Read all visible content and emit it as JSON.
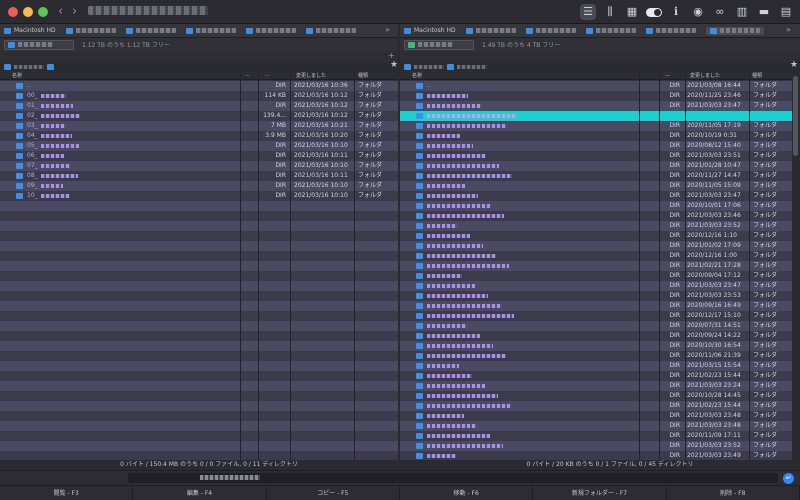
{
  "window": {
    "traffic": [
      "#ec5f59",
      "#f5bd4f",
      "#5fc454"
    ]
  },
  "toolbar": {
    "icons": [
      {
        "name": "list-view-icon",
        "glyph": "☰"
      },
      {
        "name": "columns-view-icon",
        "glyph": "⫼"
      },
      {
        "name": "grid-view-icon",
        "glyph": "▦"
      },
      {
        "name": "toggle-switch-icon",
        "glyph": ""
      },
      {
        "name": "info-icon",
        "glyph": "ℹ"
      },
      {
        "name": "eye-icon",
        "glyph": "◉"
      },
      {
        "name": "binoculars-icon",
        "glyph": "∞"
      },
      {
        "name": "panels-icon",
        "glyph": "▥"
      },
      {
        "name": "folder-icon",
        "glyph": "▬"
      },
      {
        "name": "sidebar-icon",
        "glyph": "▤"
      }
    ]
  },
  "left": {
    "tabs": [
      {
        "label": "Macintosh HD",
        "active": false
      },
      {
        "label": "",
        "active": false
      },
      {
        "label": "",
        "active": false
      },
      {
        "label": "",
        "active": false
      },
      {
        "label": "",
        "active": false
      },
      {
        "label": "",
        "active": false
      }
    ],
    "volume_info": "1.12 TB のうち 1.12 TB フリー",
    "headers": {
      "name": "名称",
      "ext": "...",
      "size": "...",
      "date": "変更しました",
      "kind": "種類"
    },
    "rows": [
      {
        "name": "..",
        "size": "DIR",
        "date": "2021/03/16 10:36",
        "kind": "フォルダ"
      },
      {
        "name": "00_",
        "size": "114 KB",
        "date": "2021/03/16 10:12",
        "kind": "フォルダ"
      },
      {
        "name": "01_",
        "size": "DIR",
        "date": "2021/03/16 10:12",
        "kind": "フォルダ"
      },
      {
        "name": "02_",
        "size": "139.4...",
        "date": "2021/03/16 10:12",
        "kind": "フォルダ"
      },
      {
        "name": "03_",
        "size": "7 MB",
        "date": "2021/03/16 10:21",
        "kind": "フォルダ"
      },
      {
        "name": "04_",
        "size": "3.9 MB",
        "date": "2021/03/16 10:20",
        "kind": "フォルダ"
      },
      {
        "name": "05_",
        "size": "DIR",
        "date": "2021/03/16 10:10",
        "kind": "フォルダ"
      },
      {
        "name": "06_",
        "size": "DIR",
        "date": "2021/03/16 10:11",
        "kind": "フォルダ"
      },
      {
        "name": "07_",
        "size": "DIR",
        "date": "2021/03/16 10:10",
        "kind": "フォルダ"
      },
      {
        "name": "08_",
        "size": "DIR",
        "date": "2021/03/16 10:11",
        "kind": "フォルダ"
      },
      {
        "name": "09_",
        "size": "DIR",
        "date": "2021/03/16 10:10",
        "kind": "フォルダ"
      },
      {
        "name": "10_",
        "size": "DIR",
        "date": "2021/03/16 10:10",
        "kind": "フォルダ"
      }
    ],
    "status": "0 バイト / 150.4 MB のうち 0 / 0 ファイル, 0 / 11 ディレクトリ"
  },
  "right": {
    "tabs": [
      {
        "label": "Macintosh HD",
        "active": false
      },
      {
        "label": "",
        "active": false
      },
      {
        "label": "",
        "active": false
      },
      {
        "label": "",
        "active": false
      },
      {
        "label": "",
        "active": false
      },
      {
        "label": "",
        "active": true
      }
    ],
    "volume_info": "1.49 TB のうち 4 TB フリー",
    "headers": {
      "name": "名称",
      "ext": "...",
      "size": "...",
      "date": "変更しました",
      "kind": "種類"
    },
    "rows": [
      {
        "name": "..",
        "size": "DIR",
        "date": "2021/03/08 16:44",
        "kind": "フォルダ"
      },
      {
        "name": "",
        "size": "DIR",
        "date": "2020/11/25 23:46",
        "kind": "フォルダ"
      },
      {
        "name": "",
        "size": "DIR",
        "date": "2021/03/03 23:47",
        "kind": "フォルダ"
      },
      {
        "name": "",
        "size": "",
        "date": "",
        "kind": "",
        "selected": true
      },
      {
        "name": "",
        "size": "DIR",
        "date": "2020/11/05 17:19",
        "kind": "フォルダ"
      },
      {
        "name": "",
        "size": "DIR",
        "date": "2020/10/19 0:31",
        "kind": "フォルダ"
      },
      {
        "name": "",
        "size": "DIR",
        "date": "2020/08/12 15:40",
        "kind": "フォルダ"
      },
      {
        "name": "",
        "size": "DIR",
        "date": "2021/03/03 23:51",
        "kind": "フォルダ"
      },
      {
        "name": "",
        "size": "DIR",
        "date": "2021/01/28 10:47",
        "kind": "フォルダ"
      },
      {
        "name": "",
        "size": "DIR",
        "date": "2020/11/27 14:47",
        "kind": "フォルダ"
      },
      {
        "name": "",
        "size": "DIR",
        "date": "2020/11/05 15:09",
        "kind": "フォルダ"
      },
      {
        "name": "",
        "size": "DIR",
        "date": "2021/03/03 23:47",
        "kind": "フォルダ"
      },
      {
        "name": "",
        "size": "DIR",
        "date": "2020/10/01 17:06",
        "kind": "フォルダ"
      },
      {
        "name": "",
        "size": "DIR",
        "date": "2021/03/03 23:46",
        "kind": "フォルダ"
      },
      {
        "name": "",
        "size": "DIR",
        "date": "2021/03/03 23:52",
        "kind": "フォルダ"
      },
      {
        "name": "",
        "size": "DIR",
        "date": "2020/12/16 1:10",
        "kind": "フォルダ"
      },
      {
        "name": "",
        "size": "DIR",
        "date": "2021/01/02 17:09",
        "kind": "フォルダ"
      },
      {
        "name": "",
        "size": "DIR",
        "date": "2020/12/16 1:00",
        "kind": "フォルダ"
      },
      {
        "name": "",
        "size": "DIR",
        "date": "2021/02/21 17:28",
        "kind": "フォルダ"
      },
      {
        "name": "",
        "size": "DIR",
        "date": "2020/09/04 17:12",
        "kind": "フォルダ"
      },
      {
        "name": "",
        "size": "DIR",
        "date": "2021/03/03 23:47",
        "kind": "フォルダ"
      },
      {
        "name": "",
        "size": "DIR",
        "date": "2021/03/03 23:53",
        "kind": "フォルダ"
      },
      {
        "name": "",
        "size": "DIR",
        "date": "2020/09/16 16:49",
        "kind": "フォルダ"
      },
      {
        "name": "",
        "size": "DIR",
        "date": "2020/12/17 15:10",
        "kind": "フォルダ"
      },
      {
        "name": "",
        "size": "DIR",
        "date": "2020/07/31 14:51",
        "kind": "フォルダ"
      },
      {
        "name": "",
        "size": "DIR",
        "date": "2020/09/24 14:22",
        "kind": "フォルダ"
      },
      {
        "name": "",
        "size": "DIR",
        "date": "2020/10/30 16:54",
        "kind": "フォルダ"
      },
      {
        "name": "",
        "size": "DIR",
        "date": "2020/11/06 21:39",
        "kind": "フォルダ"
      },
      {
        "name": "",
        "size": "DIR",
        "date": "2021/03/15 15:54",
        "kind": "フォルダ"
      },
      {
        "name": "",
        "size": "DIR",
        "date": "2021/02/23 15:44",
        "kind": "フォルダ"
      },
      {
        "name": "",
        "size": "DIR",
        "date": "2021/03/03 23:24",
        "kind": "フォルダ"
      },
      {
        "name": "",
        "size": "DIR",
        "date": "2020/10/28 14:45",
        "kind": "フォルダ"
      },
      {
        "name": "",
        "size": "DIR",
        "date": "2021/02/23 15:44",
        "kind": "フォルダ"
      },
      {
        "name": "",
        "size": "DIR",
        "date": "2021/03/03 23:48",
        "kind": "フォルダ"
      },
      {
        "name": "",
        "size": "DIR",
        "date": "2021/03/03 23:48",
        "kind": "フォルダ"
      },
      {
        "name": "",
        "size": "DIR",
        "date": "2020/11/09 17:11",
        "kind": "フォルダ"
      },
      {
        "name": "",
        "size": "DIR",
        "date": "2021/03/03 23:52",
        "kind": "フォルダ"
      },
      {
        "name": "",
        "size": "DIR",
        "date": "2021/03/03 23:49",
        "kind": "フォルダ"
      },
      {
        "name": "",
        "size": "DIR",
        "date": "2021/01/05 16:51",
        "kind": "フォルダ"
      }
    ],
    "status": "0 バイト / 20 KB のうち 0 / 1 ファイル, 0 / 45 ディレクトリ"
  },
  "fkeys": [
    "閲覧 - F3",
    "編集 - F4",
    "コピー - F5",
    "移動 - F6",
    "新規フォルダー - F7",
    "削除 - F8"
  ],
  "colors": {
    "selection": "#17d1d2",
    "name_text": "#b6a8e8",
    "folder_icon": "#3d8fe9"
  }
}
